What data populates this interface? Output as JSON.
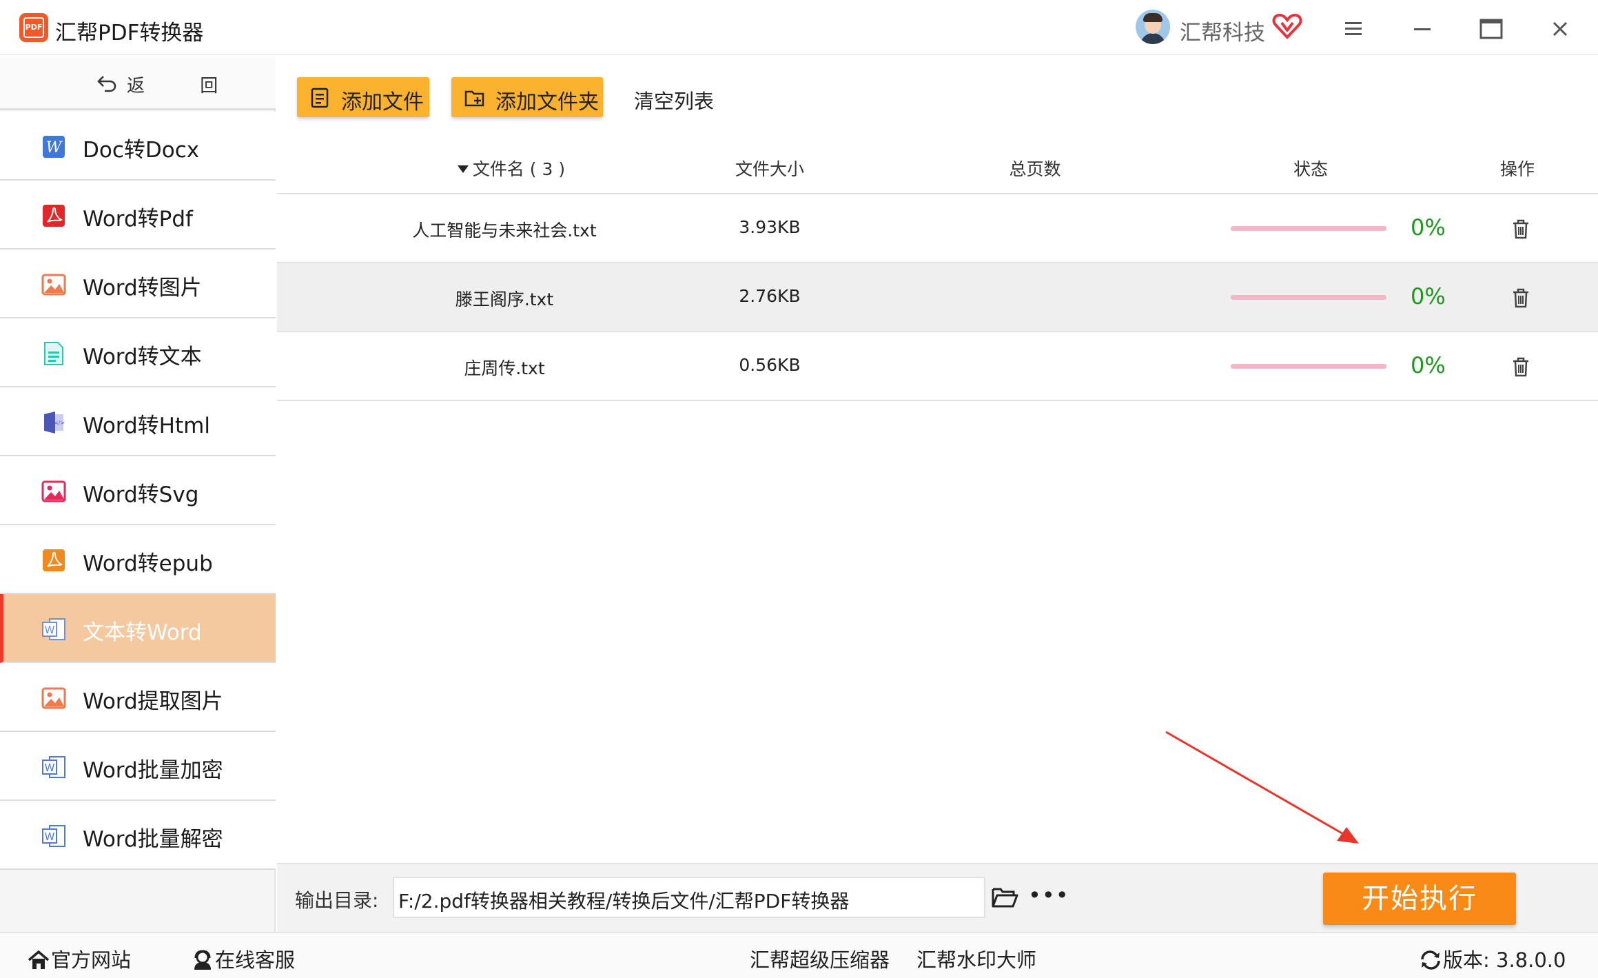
{
  "app": {
    "logo_text": "PDF",
    "title": "汇帮PDF转换器",
    "user_name": "汇帮科技"
  },
  "sidebar": {
    "back_label": "返 回",
    "items": [
      {
        "label": "Doc转Docx",
        "icon": "word-icon"
      },
      {
        "label": "Word转Pdf",
        "icon": "pdf-icon"
      },
      {
        "label": "Word转图片",
        "icon": "image-icon"
      },
      {
        "label": "Word转文本",
        "icon": "text-file-icon"
      },
      {
        "label": "Word转Html",
        "icon": "html-icon"
      },
      {
        "label": "Word转Svg",
        "icon": "svg-image-icon"
      },
      {
        "label": "Word转epub",
        "icon": "epub-icon"
      },
      {
        "label": "文本转Word",
        "icon": "word-doc-icon",
        "active": true
      },
      {
        "label": "Word提取图片",
        "icon": "image-icon"
      },
      {
        "label": "Word批量加密",
        "icon": "word-doc-icon"
      },
      {
        "label": "Word批量解密",
        "icon": "word-doc-icon"
      }
    ]
  },
  "toolbar": {
    "add_file": "添加文件",
    "add_folder": "添加文件夹",
    "clear_list": "清空列表"
  },
  "table": {
    "headers": {
      "name": "文件名 ( 3 )",
      "size": "文件大小",
      "pages": "总页数",
      "status": "状态",
      "ops": "操作"
    },
    "rows": [
      {
        "name": "人工智能与未来社会.txt",
        "size": "3.93KB",
        "pages": "",
        "progress": 0,
        "percent": "0%"
      },
      {
        "name": "滕王阁序.txt",
        "size": "2.76KB",
        "pages": "",
        "progress": 0,
        "percent": "0%"
      },
      {
        "name": "庄周传.txt",
        "size": "0.56KB",
        "pages": "",
        "progress": 0,
        "percent": "0%"
      }
    ]
  },
  "output": {
    "label": "输出目录:",
    "path": "F:/2.pdf转换器相关教程/转换后文件/汇帮PDF转换器",
    "more": "•••",
    "start_button": "开始执行"
  },
  "status_bar": {
    "website": "官方网站",
    "service": "在线客服",
    "compress": "汇帮超级压缩器",
    "watermark": "汇帮水印大师",
    "version": "版本:  3.8.0.0"
  },
  "colors": {
    "accent_yellow": "#fbb32f",
    "start_orange": "#f98a16",
    "active_item_bg": "#f5c9a0",
    "active_item_border": "#ea3b2c",
    "progress_track": "#f4b7c7",
    "percent_green": "#1c9a1c",
    "annotation_arrow": "#e8352a"
  }
}
